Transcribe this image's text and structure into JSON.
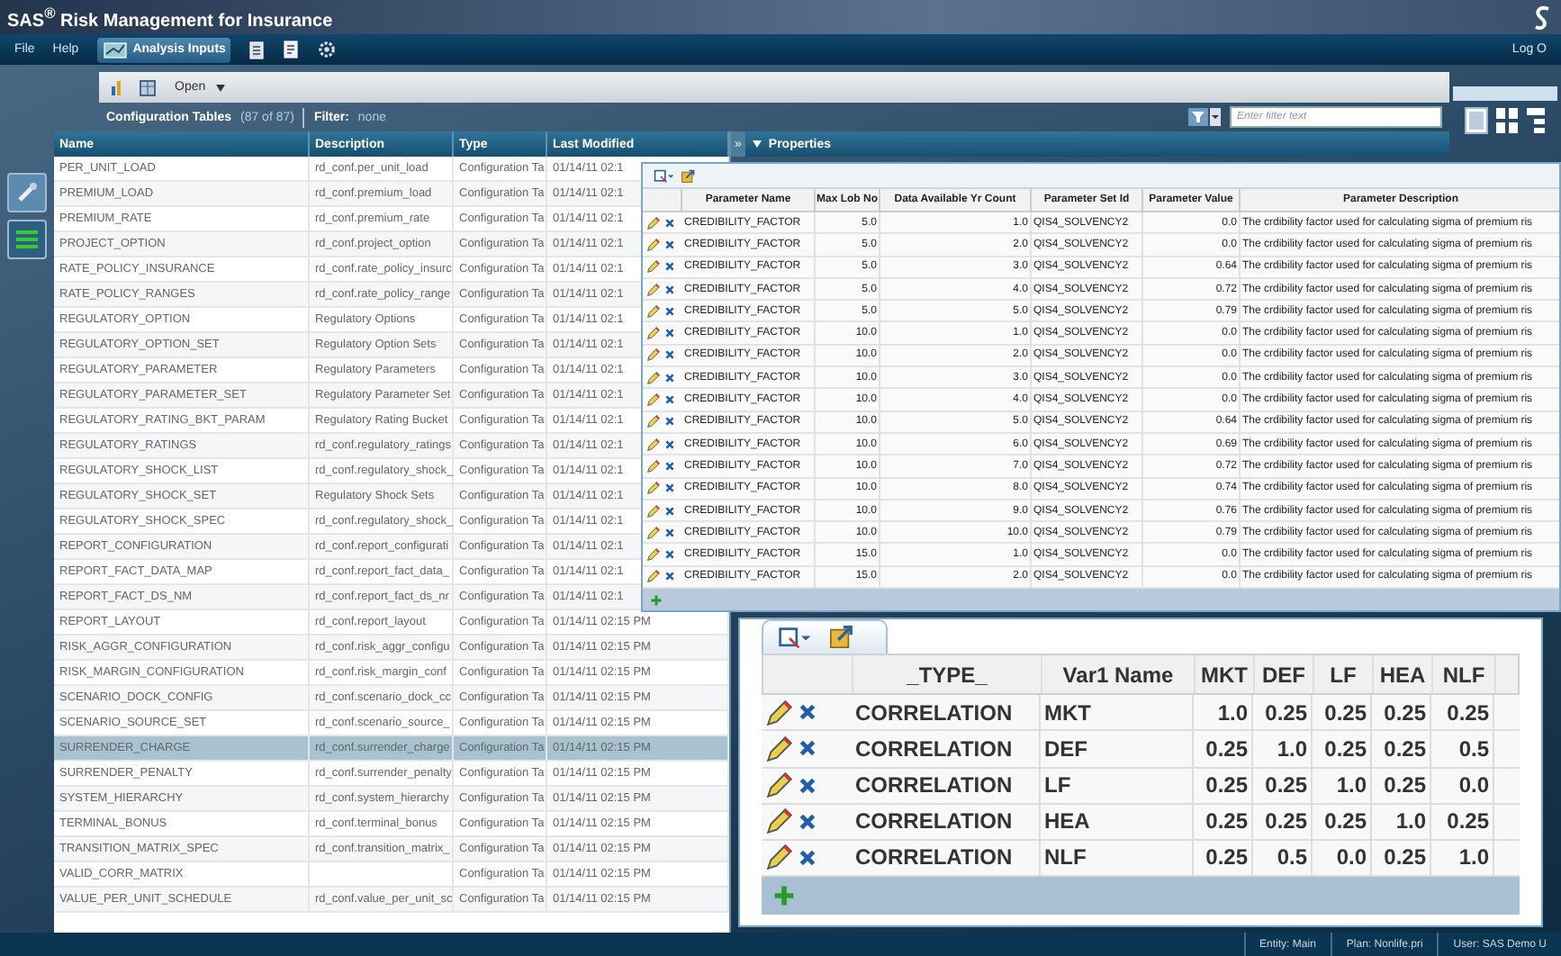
{
  "window": {
    "title": "SAS$^{®}$ Risk Management for Insurance"
  },
  "menu": [
    "File",
    "Help"
  ],
  "workspace_tabs": [
    {
      "label": "Analysis Inputs",
      "selected": true
    }
  ],
  "log_out": "Log O",
  "toolbar": {
    "open_button": "Open"
  },
  "tables_header": {
    "title": "Configuration Tables",
    "count": "(87 of 87)",
    "filter_label": "Filter:",
    "filter_value": "none",
    "search_placeholder": "Enter filter text"
  },
  "table": {
    "columns": [
      "Name",
      "Description",
      "Type",
      "Last Modified"
    ],
    "rows": [
      {
        "name": "PER_UNIT_LOAD",
        "description": "rd_conf.per_unit_load",
        "type": "Configuration Ta",
        "last_modified": "01/14/11 02:1",
        "selected": false
      },
      {
        "name": "PREMIUM_LOAD",
        "description": "rd_conf.premium_load",
        "type": "Configuration Ta",
        "last_modified": "01/14/11 02:1",
        "selected": false
      },
      {
        "name": "PREMIUM_RATE",
        "description": "rd_conf.premium_rate",
        "type": "Configuration Ta",
        "last_modified": "01/14/11 02:1",
        "selected": false
      },
      {
        "name": "PROJECT_OPTION",
        "description": "rd_conf.project_option",
        "type": "Configuration Ta",
        "last_modified": "01/14/11 02:1",
        "selected": false
      },
      {
        "name": "RATE_POLICY_INSURANCE",
        "description": "rd_conf.rate_policy_insurc",
        "type": "Configuration Ta",
        "last_modified": "01/14/11 02:1",
        "selected": false
      },
      {
        "name": "RATE_POLICY_RANGES",
        "description": "rd_conf.rate_policy_range",
        "type": "Configuration Ta",
        "last_modified": "01/14/11 02:1",
        "selected": false
      },
      {
        "name": "REGULATORY_OPTION",
        "description": "Regulatory Options",
        "type": "Configuration Ta",
        "last_modified": "01/14/11 02:1",
        "selected": false
      },
      {
        "name": "REGULATORY_OPTION_SET",
        "description": "Regulatory Option Sets",
        "type": "Configuration Ta",
        "last_modified": "01/14/11 02:1",
        "selected": false
      },
      {
        "name": "REGULATORY_PARAMETER",
        "description": "Regulatory Parameters",
        "type": "Configuration Ta",
        "last_modified": "01/14/11 02:1",
        "selected": false
      },
      {
        "name": "REGULATORY_PARAMETER_SET",
        "description": "Regulatory Parameter Set",
        "type": "Configuration Ta",
        "last_modified": "01/14/11 02:1",
        "selected": false
      },
      {
        "name": "REGULATORY_RATING_BKT_PARAM",
        "description": "Regulatory Rating Bucket",
        "type": "Configuration Ta",
        "last_modified": "01/14/11 02:1",
        "selected": false
      },
      {
        "name": "REGULATORY_RATINGS",
        "description": "rd_conf.regulatory_ratings",
        "type": "Configuration Ta",
        "last_modified": "01/14/11 02:1",
        "selected": false
      },
      {
        "name": "REGULATORY_SHOCK_LIST",
        "description": "rd_conf.regulatory_shock_",
        "type": "Configuration Ta",
        "last_modified": "01/14/11 02:1",
        "selected": false
      },
      {
        "name": "REGULATORY_SHOCK_SET",
        "description": "Regulatory Shock Sets",
        "type": "Configuration Ta",
        "last_modified": "01/14/11 02:1",
        "selected": false
      },
      {
        "name": "REGULATORY_SHOCK_SPEC",
        "description": "rd_conf.regulatory_shock_",
        "type": "Configuration Ta",
        "last_modified": "01/14/11 02:1",
        "selected": false
      },
      {
        "name": "REPORT_CONFIGURATION",
        "description": "rd_conf.report_configurati",
        "type": "Configuration Ta",
        "last_modified": "01/14/11 02:1",
        "selected": false
      },
      {
        "name": "REPORT_FACT_DATA_MAP",
        "description": "rd_conf.report_fact_data_",
        "type": "Configuration Ta",
        "last_modified": "01/14/11 02:1",
        "selected": false
      },
      {
        "name": "REPORT_FACT_DS_NM",
        "description": "rd_conf.report_fact_ds_nr",
        "type": "Configuration Ta",
        "last_modified": "01/14/11 02:1",
        "selected": false
      },
      {
        "name": "REPORT_LAYOUT",
        "description": "rd_conf.report_layout",
        "type": "Configuration Ta",
        "last_modified": "01/14/11 02:15 PM",
        "selected": false
      },
      {
        "name": "RISK_AGGR_CONFIGURATION",
        "description": "rd_conf.risk_aggr_configu",
        "type": "Configuration Ta",
        "last_modified": "01/14/11 02:15 PM",
        "selected": false
      },
      {
        "name": "RISK_MARGIN_CONFIGURATION",
        "description": "rd_conf.risk_margin_conf",
        "type": "Configuration Ta",
        "last_modified": "01/14/11 02:15 PM",
        "selected": false
      },
      {
        "name": "SCENARIO_DOCK_CONFIG",
        "description": "rd_conf.scenario_dock_cc",
        "type": "Configuration Ta",
        "last_modified": "01/14/11 02:15 PM",
        "selected": false
      },
      {
        "name": "SCENARIO_SOURCE_SET",
        "description": "rd_conf.scenario_source_",
        "type": "Configuration Ta",
        "last_modified": "01/14/11 02:15 PM",
        "selected": false
      },
      {
        "name": "SURRENDER_CHARGE",
        "description": "rd_conf.surrender_charge",
        "type": "Configuration Ta",
        "last_modified": "01/14/11 02:15 PM",
        "selected": true
      },
      {
        "name": "SURRENDER_PENALTY",
        "description": "rd_conf.surrender_penalty",
        "type": "Configuration Ta",
        "last_modified": "01/14/11 02:15 PM",
        "selected": false
      },
      {
        "name": "SYSTEM_HIERARCHY",
        "description": "rd_conf.system_hierarchy",
        "type": "Configuration Ta",
        "last_modified": "01/14/11 02:15 PM",
        "selected": false
      },
      {
        "name": "TERMINAL_BONUS",
        "description": "rd_conf.terminal_bonus",
        "type": "Configuration Ta",
        "last_modified": "01/14/11 02:15 PM",
        "selected": false
      },
      {
        "name": "TRANSITION_MATRIX_SPEC",
        "description": "rd_conf.transition_matrix_",
        "type": "Configuration Ta",
        "last_modified": "01/14/11 02:15 PM",
        "selected": false
      },
      {
        "name": "VALID_CORR_MATRIX",
        "type": "Configuration Ta",
        "last_modified": "01/14/11 02:15 PM",
        "selected": false
      },
      {
        "name": "VALUE_PER_UNIT_SCHEDULE",
        "description": "rd_conf.value_per_unit_sc",
        "type": "Configuration Ta",
        "last_modified": "01/14/11 02:15 PM",
        "selected": false
      }
    ]
  },
  "properties": {
    "collapse": "»",
    "title": "Properties"
  },
  "parameter_grid": {
    "columns": [
      "Parameter Name",
      "Max Lob No",
      "Data Available Yr Count",
      "Parameter Set Id",
      "Parameter Value",
      "Parameter Description"
    ],
    "rows": [
      [
        "CREDIBILITY_FACTOR",
        "5.0",
        "1.0",
        "QIS4_SOLVENCY2",
        "0.0",
        "The crdibility factor used for calculating sigma of premium ris"
      ],
      [
        "CREDIBILITY_FACTOR",
        "5.0",
        "2.0",
        "QIS4_SOLVENCY2",
        "0.0",
        "The crdibility factor used for calculating sigma of premium ris"
      ],
      [
        "CREDIBILITY_FACTOR",
        "5.0",
        "3.0",
        "QIS4_SOLVENCY2",
        "0.64",
        "The crdibility factor used for calculating sigma of premium ris"
      ],
      [
        "CREDIBILITY_FACTOR",
        "5.0",
        "4.0",
        "QIS4_SOLVENCY2",
        "0.72",
        "The crdibility factor used for calculating sigma of premium ris"
      ],
      [
        "CREDIBILITY_FACTOR",
        "5.0",
        "5.0",
        "QIS4_SOLVENCY2",
        "0.79",
        "The crdibility factor used for calculating sigma of premium ris"
      ],
      [
        "CREDIBILITY_FACTOR",
        "10.0",
        "1.0",
        "QIS4_SOLVENCY2",
        "0.0",
        "The crdibility factor used for calculating sigma of premium ris"
      ],
      [
        "CREDIBILITY_FACTOR",
        "10.0",
        "2.0",
        "QIS4_SOLVENCY2",
        "0.0",
        "The crdibility factor used for calculating sigma of premium ris"
      ],
      [
        "CREDIBILITY_FACTOR",
        "10.0",
        "3.0",
        "QIS4_SOLVENCY2",
        "0.0",
        "The crdibility factor used for calculating sigma of premium ris"
      ],
      [
        "CREDIBILITY_FACTOR",
        "10.0",
        "4.0",
        "QIS4_SOLVENCY2",
        "0.0",
        "The crdibility factor used for calculating sigma of premium ris"
      ],
      [
        "CREDIBILITY_FACTOR",
        "10.0",
        "5.0",
        "QIS4_SOLVENCY2",
        "0.64",
        "The crdibility factor used for calculating sigma of premium ris"
      ],
      [
        "CREDIBILITY_FACTOR",
        "10.0",
        "6.0",
        "QIS4_SOLVENCY2",
        "0.69",
        "The crdibility factor used for calculating sigma of premium ris"
      ],
      [
        "CREDIBILITY_FACTOR",
        "10.0",
        "7.0",
        "QIS4_SOLVENCY2",
        "0.72",
        "The crdibility factor used for calculating sigma of premium ris"
      ],
      [
        "CREDIBILITY_FACTOR",
        "10.0",
        "8.0",
        "QIS4_SOLVENCY2",
        "0.74",
        "The crdibility factor used for calculating sigma of premium ris"
      ],
      [
        "CREDIBILITY_FACTOR",
        "10.0",
        "9.0",
        "QIS4_SOLVENCY2",
        "0.76",
        "The crdibility factor used for calculating sigma of premium ris"
      ],
      [
        "CREDIBILITY_FACTOR",
        "10.0",
        "10.0",
        "QIS4_SOLVENCY2",
        "0.79",
        "The crdibility factor used for calculating sigma of premium ris"
      ],
      [
        "CREDIBILITY_FACTOR",
        "15.0",
        "1.0",
        "QIS4_SOLVENCY2",
        "0.0",
        "The crdibility factor used for calculating sigma of premium ris"
      ],
      [
        "CREDIBILITY_FACTOR",
        "15.0",
        "2.0",
        "QIS4_SOLVENCY2",
        "0.0",
        "The crdibility factor used for calculating sigma of premium ris"
      ]
    ]
  },
  "correlation_grid": {
    "columns": [
      "_TYPE_",
      "Var1 Name",
      "MKT",
      "DEF",
      "LF",
      "HEA",
      "NLF"
    ],
    "rows": [
      [
        "CORRELATION",
        "MKT",
        "1.0",
        "0.25",
        "0.25",
        "0.25",
        "0.25"
      ],
      [
        "CORRELATION",
        "DEF",
        "0.25",
        "1.0",
        "0.25",
        "0.25",
        "0.5"
      ],
      [
        "CORRELATION",
        "LF",
        "0.25",
        "0.25",
        "1.0",
        "0.25",
        "0.0"
      ],
      [
        "CORRELATION",
        "HEA",
        "0.25",
        "0.25",
        "0.25",
        "1.0",
        "0.25"
      ],
      [
        "CORRELATION",
        "NLF",
        "0.25",
        "0.5",
        "0.0",
        "0.25",
        "1.0"
      ]
    ]
  },
  "status_bar": [
    {
      "label": "Entity:",
      "value": "Main"
    },
    {
      "label": "Plan:",
      "value": "Nonlife.pri"
    },
    {
      "label": "User:",
      "value": "SAS Demo U"
    }
  ]
}
